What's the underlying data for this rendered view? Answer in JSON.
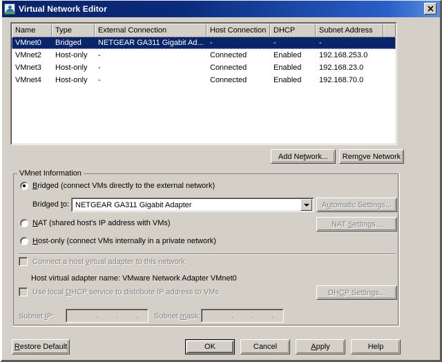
{
  "window": {
    "title": "Virtual Network Editor",
    "icon": "vmware-network-icon",
    "close_label": "✕"
  },
  "network_table": {
    "columns": [
      "Name",
      "Type",
      "External Connection",
      "Host Connection",
      "DHCP",
      "Subnet Address"
    ],
    "rows": [
      {
        "name": "VMnet0",
        "type": "Bridged",
        "external_connection": "NETGEAR GA311 Gigabit Ad...",
        "host_connection": "-",
        "dhcp": "-",
        "subnet_address": "-",
        "selected": true
      },
      {
        "name": "VMnet2",
        "type": "Host-only",
        "external_connection": "-",
        "host_connection": "Connected",
        "dhcp": "Enabled",
        "subnet_address": "192.168.253.0",
        "selected": false
      },
      {
        "name": "VMnet3",
        "type": "Host-only",
        "external_connection": "-",
        "host_connection": "Connected",
        "dhcp": "Enabled",
        "subnet_address": "192.168.23.0",
        "selected": false
      },
      {
        "name": "VMnet4",
        "type": "Host-only",
        "external_connection": "-",
        "host_connection": "Connected",
        "dhcp": "Enabled",
        "subnet_address": "192.168.70.0",
        "selected": false
      }
    ]
  },
  "table_buttons": {
    "add_network": "Add Network...",
    "remove_network": "Remove Network"
  },
  "vmnet_info": {
    "legend": "VMnet Information",
    "bridged_radio": "Bridged (connect VMs directly to the external network)",
    "bridged_selected": true,
    "bridged_to_label": "Bridged to:",
    "bridged_to_value": "NETGEAR GA311 Gigabit Adapter",
    "automatic_settings": "Automatic Settings...",
    "nat_radio": "NAT (shared host's IP address with VMs)",
    "nat_selected": false,
    "nat_settings": "NAT Settings...",
    "hostonly_radio": "Host-only (connect VMs internally in a private network)",
    "hostonly_selected": false,
    "connect_host_adapter": "Connect a host virtual adapter to this network",
    "connect_host_adapter_checked": false,
    "host_adapter_name": "Host virtual adapter name: VMware Network Adapter VMnet0",
    "use_local_dhcp": "Use local DHCP service to distribute IP address to VMs",
    "use_local_dhcp_checked": false,
    "dhcp_settings": "DHCP Settings...",
    "subnet_ip_label": "Subnet IP:",
    "subnet_ip_value": "",
    "subnet_mask_label": "Subnet mask:",
    "subnet_mask_value": ""
  },
  "footer_buttons": {
    "restore_default": "Restore Default",
    "ok": "OK",
    "cancel": "Cancel",
    "apply": "Apply",
    "help": "Help"
  },
  "colors": {
    "title_gradient_start": "#0a246a",
    "title_gradient_end": "#5b8ede",
    "face": "#d4d0c8",
    "selection": "#0a246a",
    "disabled_text": "#808080"
  }
}
